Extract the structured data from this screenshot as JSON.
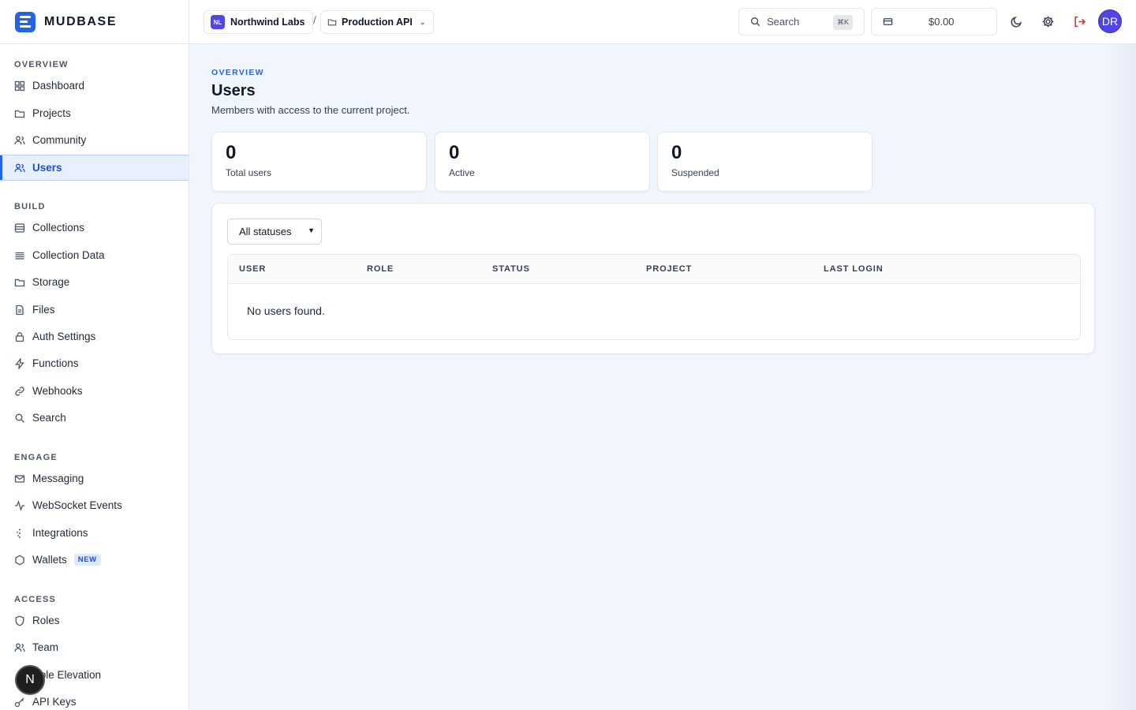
{
  "brand": {
    "name": "MUDBASE"
  },
  "sidebar": {
    "sections": [
      {
        "title": "OVERVIEW",
        "items": [
          {
            "label": "Dashboard",
            "icon": "grid-icon"
          },
          {
            "label": "Projects",
            "icon": "folder-icon"
          },
          {
            "label": "Community",
            "icon": "users-icon"
          },
          {
            "label": "Users",
            "icon": "users-icon",
            "active": true
          }
        ]
      },
      {
        "title": "BUILD",
        "items": [
          {
            "label": "Collections",
            "icon": "database-icon"
          },
          {
            "label": "Collection Data",
            "icon": "list-icon"
          },
          {
            "label": "Storage",
            "icon": "folder-icon"
          },
          {
            "label": "Files",
            "icon": "file-icon"
          },
          {
            "label": "Auth Settings",
            "icon": "lock-icon"
          },
          {
            "label": "Functions",
            "icon": "bolt-icon"
          },
          {
            "label": "Webhooks",
            "icon": "link-icon"
          },
          {
            "label": "Search",
            "icon": "search-icon"
          }
        ]
      },
      {
        "title": "ENGAGE",
        "items": [
          {
            "label": "Messaging",
            "icon": "mail-icon"
          },
          {
            "label": "WebSocket Events",
            "icon": "activity-icon"
          },
          {
            "label": "Integrations",
            "icon": "sparkle-icon"
          },
          {
            "label": "Wallets",
            "icon": "hexagon-icon",
            "badge": "NEW"
          }
        ]
      },
      {
        "title": "ACCESS",
        "items": [
          {
            "label": "Roles",
            "icon": "shield-icon"
          },
          {
            "label": "Team",
            "icon": "users-icon"
          },
          {
            "label": "Role Elevation",
            "icon": "arrow-up-icon"
          },
          {
            "label": "API Keys",
            "icon": "key-icon"
          }
        ]
      }
    ],
    "floating_badge": "N"
  },
  "topbar": {
    "org": {
      "initials": "NL",
      "name": "Northwind Labs"
    },
    "separator": "/",
    "project": {
      "name": "Production API"
    },
    "search": {
      "label": "Search",
      "shortcut": "⌘K"
    },
    "balance": "$0.00",
    "avatar_initials": "DR"
  },
  "page": {
    "eyebrow": "OVERVIEW",
    "title": "Users",
    "subtitle": "Members with access to the current project."
  },
  "stats": [
    {
      "value": "0",
      "label": "Total users"
    },
    {
      "value": "0",
      "label": "Active"
    },
    {
      "value": "0",
      "label": "Suspended"
    }
  ],
  "filter": {
    "selected": "All statuses"
  },
  "table": {
    "columns": [
      "USER",
      "ROLE",
      "STATUS",
      "PROJECT",
      "LAST LOGIN"
    ],
    "empty_message": "No users found."
  },
  "colors": {
    "accent": "#2563eb",
    "org_badge": "#4f46e5",
    "logout": "#dc2626"
  }
}
